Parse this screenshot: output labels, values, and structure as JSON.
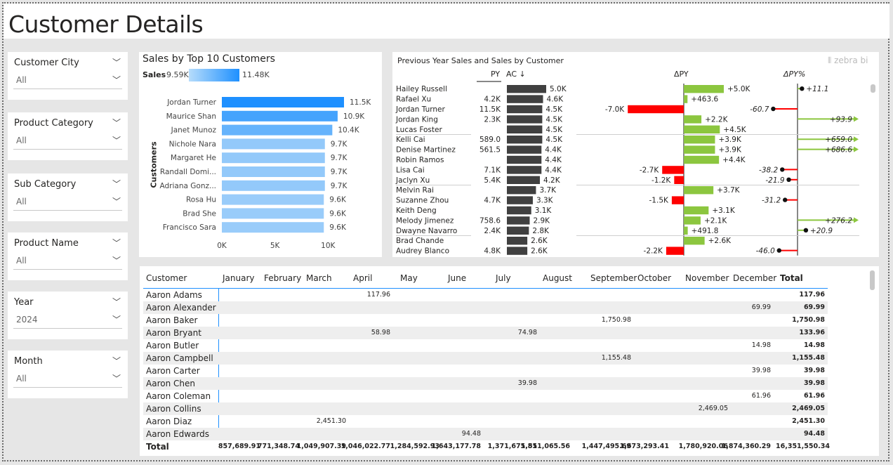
{
  "page": {
    "title": "Customer Details"
  },
  "slicers": [
    {
      "label": "Customer City",
      "value": "All"
    },
    {
      "label": "Product Category",
      "value": "All"
    },
    {
      "label": "Sub Category",
      "value": "All"
    },
    {
      "label": "Product Name",
      "value": "All"
    },
    {
      "label": "Year",
      "value": "2024"
    },
    {
      "label": "Month",
      "value": "All"
    }
  ],
  "bar_chart": {
    "title": "Sales by Top 10 Customers",
    "legend_label": "Sales",
    "legend_min": "9.59K",
    "legend_max": "11.48K",
    "ylabel": "Customers",
    "x_ticks": [
      "0K",
      "5K",
      "10K"
    ]
  },
  "zebra": {
    "title": "Previous Year Sales and Sales by Customer",
    "brand": "zebra bi",
    "col_py": "PY",
    "col_ac": "AC ↓",
    "col_dpy": "ΔPY",
    "col_dpypct": "ΔPY%",
    "rows": [
      {
        "name": "Hailey Russell",
        "py": "",
        "ac": "5.0K",
        "acv": 5.0,
        "dpy": "+5.0K",
        "dpyv": 5.0,
        "pct": "+11.1",
        "pctv": 11.1
      },
      {
        "name": "Rafael Xu",
        "py": "4.2K",
        "ac": "4.6K",
        "acv": 4.6,
        "dpy": "+463.6",
        "dpyv": 0.4636,
        "pct": "",
        "pctv": null
      },
      {
        "name": "Jordan Turner",
        "py": "11.5K",
        "ac": "4.5K",
        "acv": 4.5,
        "dpy": "-7.0K",
        "dpyv": -7.0,
        "pct": "-60.7",
        "pctv": -60.7
      },
      {
        "name": "Jordan King",
        "py": "2.3K",
        "ac": "4.5K",
        "acv": 4.5,
        "dpy": "+2.2K",
        "dpyv": 2.2,
        "pct": "+93.9",
        "pctv": 93.9
      },
      {
        "name": "Lucas Foster",
        "py": "",
        "ac": "4.5K",
        "acv": 4.5,
        "dpy": "+4.5K",
        "dpyv": 4.5,
        "pct": "",
        "pctv": null
      },
      {
        "name": "Kelli Cai",
        "py": "589.0",
        "ac": "4.5K",
        "acv": 4.5,
        "dpy": "+3.9K",
        "dpyv": 3.9,
        "pct": "+659.0",
        "pctv": 659.0
      },
      {
        "name": "Denise Martinez",
        "py": "561.5",
        "ac": "4.4K",
        "acv": 4.4,
        "dpy": "+3.9K",
        "dpyv": 3.9,
        "pct": "+686.6",
        "pctv": 686.6
      },
      {
        "name": "Robin Ramos",
        "py": "",
        "ac": "4.4K",
        "acv": 4.4,
        "dpy": "+4.4K",
        "dpyv": 4.4,
        "pct": "",
        "pctv": null
      },
      {
        "name": "Lisa Cai",
        "py": "7.1K",
        "ac": "4.4K",
        "acv": 4.4,
        "dpy": "-2.7K",
        "dpyv": -2.7,
        "pct": "-38.2",
        "pctv": -38.2
      },
      {
        "name": "Jaclyn Xu",
        "py": "5.4K",
        "ac": "4.2K",
        "acv": 4.2,
        "dpy": "-1.2K",
        "dpyv": -1.2,
        "pct": "-21.9",
        "pctv": -21.9
      },
      {
        "name": "Melvin Rai",
        "py": "",
        "ac": "3.7K",
        "acv": 3.7,
        "dpy": "+3.7K",
        "dpyv": 3.7,
        "pct": "",
        "pctv": null
      },
      {
        "name": "Suzanne Zhou",
        "py": "4.7K",
        "ac": "3.3K",
        "acv": 3.3,
        "dpy": "-1.5K",
        "dpyv": -1.5,
        "pct": "-31.2",
        "pctv": -31.2
      },
      {
        "name": "Keith Deng",
        "py": "",
        "ac": "3.1K",
        "acv": 3.1,
        "dpy": "+3.1K",
        "dpyv": 3.1,
        "pct": "",
        "pctv": null
      },
      {
        "name": "Melody Jimenez",
        "py": "758.6",
        "ac": "2.9K",
        "acv": 2.9,
        "dpy": "+2.1K",
        "dpyv": 2.1,
        "pct": "+276.2",
        "pctv": 276.2
      },
      {
        "name": "Dwayne Navarro",
        "py": "2.4K",
        "ac": "2.8K",
        "acv": 2.8,
        "dpy": "+491.8",
        "dpyv": 0.4918,
        "pct": "+20.9",
        "pctv": 20.9
      },
      {
        "name": "Brad Chande",
        "py": "",
        "ac": "2.6K",
        "acv": 2.6,
        "dpy": "+2.6K",
        "dpyv": 2.6,
        "pct": "",
        "pctv": null
      },
      {
        "name": "Audrey Blanco",
        "py": "4.8K",
        "ac": "2.6K",
        "acv": 2.6,
        "dpy": "-2.2K",
        "dpyv": -2.2,
        "pct": "-46.0",
        "pctv": -46.0
      }
    ]
  },
  "chart_data": {
    "type": "bar",
    "title": "Sales by Top 10 Customers",
    "xlabel": "",
    "ylabel": "Customers",
    "categories": [
      "Jordan Turner",
      "Maurice Shan",
      "Janet Munoz",
      "Nichole Nara",
      "Margaret He",
      "Randall Domi...",
      "Adriana Gonz...",
      "Rosa Hu",
      "Brad She",
      "Francisco Sara"
    ],
    "values": [
      11.5,
      10.9,
      10.4,
      9.7,
      9.7,
      9.7,
      9.7,
      9.6,
      9.6,
      9.6
    ],
    "labels": [
      "11.5K",
      "10.9K",
      "10.4K",
      "9.7K",
      "9.7K",
      "9.7K",
      "9.7K",
      "9.6K",
      "9.6K",
      "9.6K"
    ],
    "xlim": [
      0,
      11.5
    ]
  },
  "table": {
    "header_customer": "Customer",
    "months": [
      "January",
      "February",
      "March",
      "April",
      "May",
      "June",
      "July",
      "August",
      "September",
      "October",
      "November",
      "December"
    ],
    "header_total": "Total",
    "rows": [
      {
        "name": "Aaron Adams",
        "cells": {
          "3": "117.96"
        },
        "total": "117.96"
      },
      {
        "name": "Aaron Alexander",
        "cells": {
          "11": "69.99"
        },
        "total": "69.99"
      },
      {
        "name": "Aaron Baker",
        "cells": {
          "8": "1,750.98"
        },
        "total": "1,750.98"
      },
      {
        "name": "Aaron Bryant",
        "cells": {
          "3": "58.98",
          "6": "74.98"
        },
        "total": "133.96"
      },
      {
        "name": "Aaron Butler",
        "cells": {
          "11": "14.98"
        },
        "total": "14.98"
      },
      {
        "name": "Aaron Campbell",
        "cells": {
          "8": "1,155.48"
        },
        "total": "1,155.48"
      },
      {
        "name": "Aaron Carter",
        "cells": {
          "11": "39.98"
        },
        "total": "39.98"
      },
      {
        "name": "Aaron Chen",
        "cells": {
          "6": "39.98"
        },
        "total": "39.98"
      },
      {
        "name": "Aaron Coleman",
        "cells": {
          "11": "61.96"
        },
        "total": "61.96"
      },
      {
        "name": "Aaron Collins",
        "cells": {
          "10": "2,469.05"
        },
        "total": "2,469.05"
      },
      {
        "name": "Aaron Diaz",
        "cells": {
          "2": "2,451.30"
        },
        "total": "2,451.30"
      },
      {
        "name": "Aaron Edwards",
        "cells": {
          "5": "94.48"
        },
        "total": "94.48"
      }
    ],
    "totals_label": "Total",
    "totals": [
      "857,689.91",
      "771,348.74",
      "1,049,907.39",
      "1,046,022.77",
      "1,284,592.93",
      "1,643,177.78",
      "1,371,675.81",
      "1,551,065.56",
      "1,447,495.69",
      "1,673,293.41",
      "1,780,920.06",
      "1,874,360.29"
    ],
    "grand_total": "16,351,550.34"
  },
  "colors": {
    "ac_bar": "#404040",
    "positive": "#8cc63f",
    "negative": "#ff0000",
    "bar_dark": "#1e90ff",
    "bar_light": "#99ccfa"
  }
}
